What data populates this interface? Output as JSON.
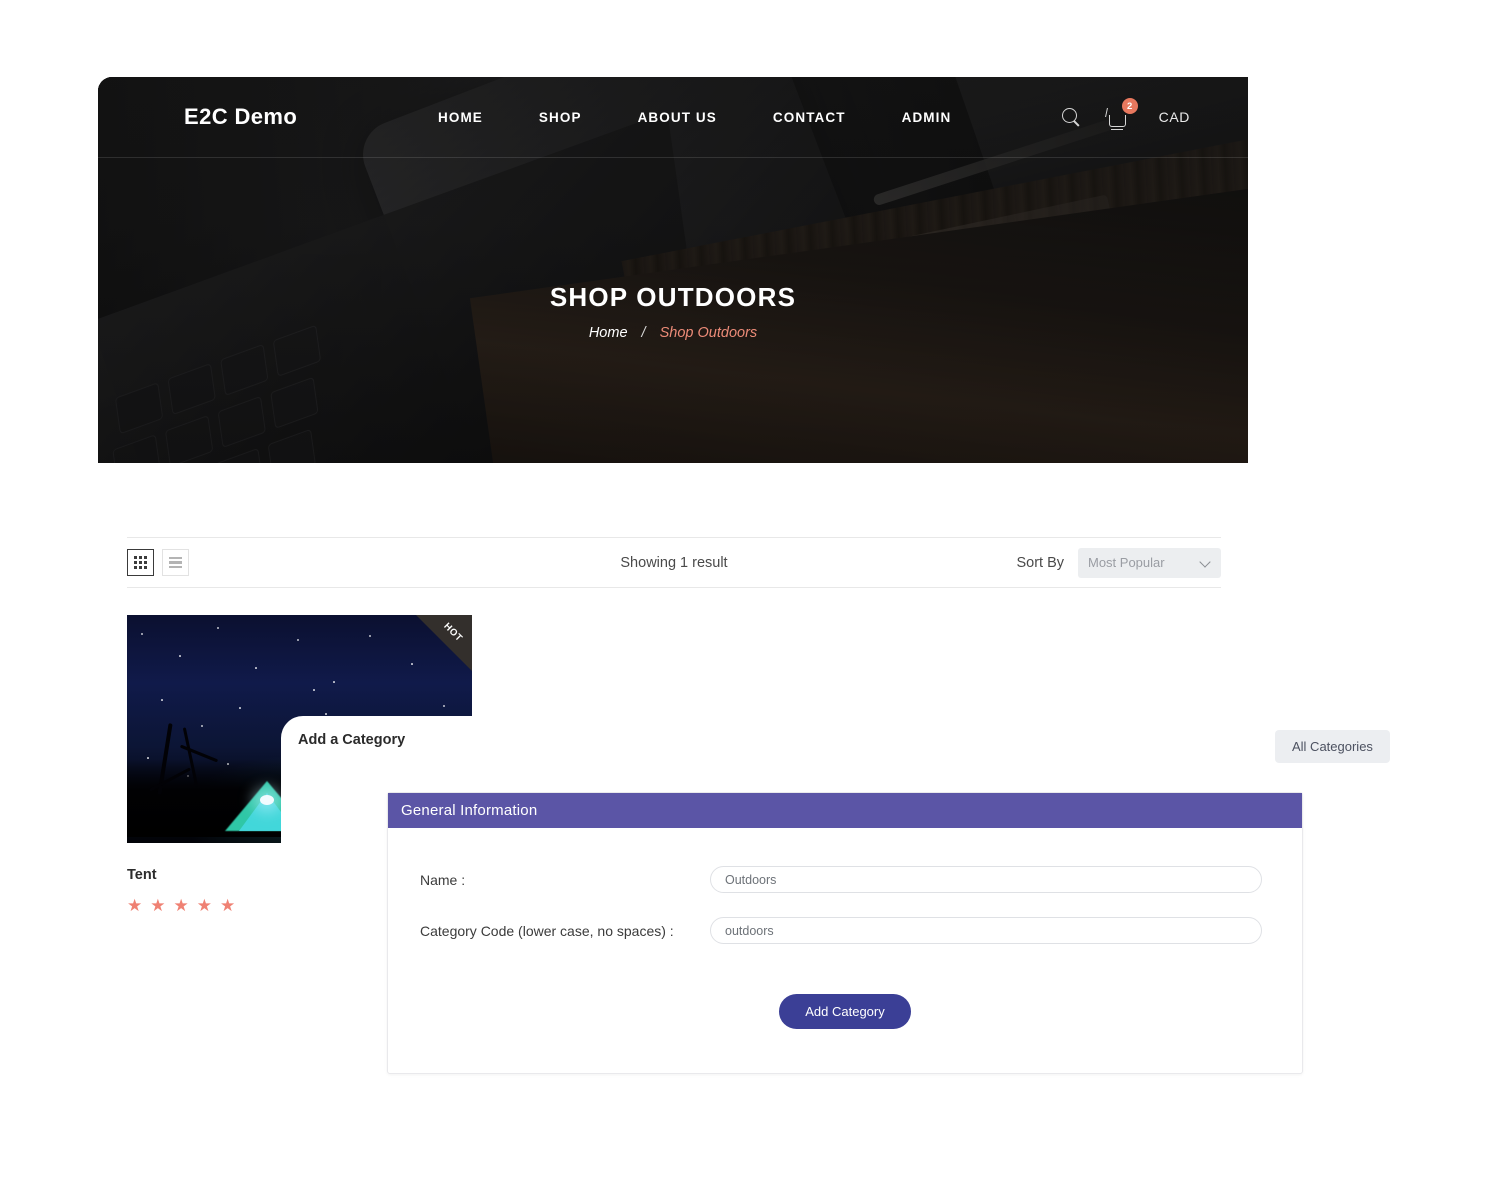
{
  "header": {
    "brand": "E2C Demo",
    "nav": [
      {
        "label": "HOME"
      },
      {
        "label": "SHOP"
      },
      {
        "label": "ABOUT US"
      },
      {
        "label": "CONTACT"
      },
      {
        "label": "ADMIN"
      }
    ],
    "search_icon": "search-icon",
    "cart_icon": "cart-icon",
    "cart_count": "2",
    "currency": "CAD"
  },
  "hero": {
    "title": "SHOP OUTDOORS",
    "breadcrumb_home": "Home",
    "breadcrumb_sep": "/",
    "breadcrumb_current": "Shop Outdoors"
  },
  "toolbar": {
    "grid_view_icon": "grid-view-icon",
    "list_view_icon": "list-view-icon",
    "showing": "Showing 1 result",
    "sort_label": "Sort By",
    "sort_value": "Most Popular",
    "sort_options": [
      "Most Popular"
    ]
  },
  "product": {
    "badge": "HOT",
    "name": "Tent",
    "rating_stars": 5,
    "star_glyph": "★"
  },
  "category_panel": {
    "title": "Add a Category",
    "all_categories_label": "All Categories",
    "card_header": "General Information",
    "fields": [
      {
        "label": "Name :",
        "value": "Outdoors"
      },
      {
        "label": "Category Code (lower case, no spaces) :",
        "value": "outdoors"
      }
    ],
    "submit_label": "Add Category"
  },
  "colors": {
    "accent_purple": "#5b55a6",
    "submit_blue": "#3b3f96",
    "coral": "#ef8173",
    "badge_orange": "#e8785e",
    "breadcrumb_active": "#ec8b78"
  }
}
